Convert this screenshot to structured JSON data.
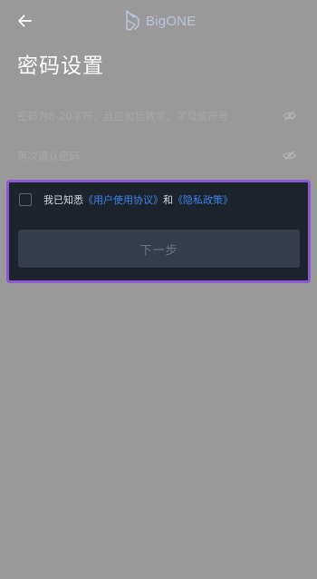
{
  "header": {
    "back_icon": "arrow-left-icon",
    "brand": {
      "logo_icon": "bigone-logo-icon",
      "name": "BigONE",
      "color": "#b9c6e2"
    }
  },
  "page": {
    "title": "密码设置"
  },
  "form": {
    "password": {
      "placeholder": "密码为8-20字符，且应包括数字、字母或符号",
      "value": "",
      "toggle_icon": "eye-icon"
    },
    "confirm_password": {
      "placeholder": "再次确认密码",
      "value": "",
      "toggle_icon": "eye-icon"
    }
  },
  "agreement": {
    "checked": false,
    "prefix": "我已知悉",
    "user_agreement": "《用户使用协议》",
    "connector": "和",
    "privacy_policy": "《隐私政策》"
  },
  "actions": {
    "next_label": "下一步"
  },
  "colors": {
    "overlay": "#999999",
    "panel_background": "#1c232c",
    "highlight_border": "#8a58d3",
    "link": "#3e84ec",
    "button_background": "#353d48",
    "button_text": "#6e7480"
  }
}
